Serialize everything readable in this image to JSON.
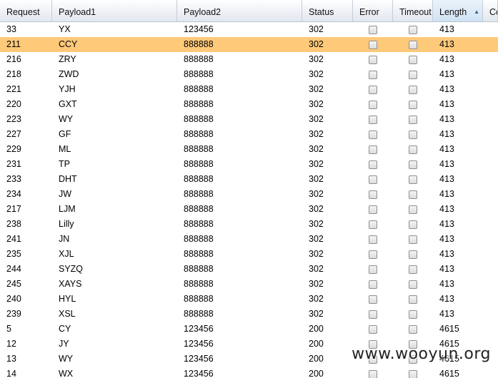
{
  "columns": {
    "request": "Request",
    "payload1": "Payload1",
    "payload2": "Payload2",
    "status": "Status",
    "error": "Error",
    "timeout": "Timeout",
    "length": "Length",
    "comment": "Co"
  },
  "sort": {
    "column": "Length",
    "direction": "ascending",
    "arrow": "▲"
  },
  "selected_row_index": 1,
  "selection_color": "#ffc97a",
  "rows": [
    {
      "request": "33",
      "payload1": "YX",
      "payload2": "123456",
      "status": "302",
      "error": false,
      "timeout": false,
      "length": "413"
    },
    {
      "request": "211",
      "payload1": "CCY",
      "payload2": "888888",
      "status": "302",
      "error": false,
      "timeout": false,
      "length": "413"
    },
    {
      "request": "216",
      "payload1": "ZRY",
      "payload2": "888888",
      "status": "302",
      "error": false,
      "timeout": false,
      "length": "413"
    },
    {
      "request": "218",
      "payload1": "ZWD",
      "payload2": "888888",
      "status": "302",
      "error": false,
      "timeout": false,
      "length": "413"
    },
    {
      "request": "221",
      "payload1": "YJH",
      "payload2": "888888",
      "status": "302",
      "error": false,
      "timeout": false,
      "length": "413"
    },
    {
      "request": "220",
      "payload1": "GXT",
      "payload2": "888888",
      "status": "302",
      "error": false,
      "timeout": false,
      "length": "413"
    },
    {
      "request": "223",
      "payload1": "WY",
      "payload2": "888888",
      "status": "302",
      "error": false,
      "timeout": false,
      "length": "413"
    },
    {
      "request": "227",
      "payload1": "GF",
      "payload2": "888888",
      "status": "302",
      "error": false,
      "timeout": false,
      "length": "413"
    },
    {
      "request": "229",
      "payload1": "ML",
      "payload2": "888888",
      "status": "302",
      "error": false,
      "timeout": false,
      "length": "413"
    },
    {
      "request": "231",
      "payload1": "TP",
      "payload2": "888888",
      "status": "302",
      "error": false,
      "timeout": false,
      "length": "413"
    },
    {
      "request": "233",
      "payload1": "DHT",
      "payload2": "888888",
      "status": "302",
      "error": false,
      "timeout": false,
      "length": "413"
    },
    {
      "request": "234",
      "payload1": "JW",
      "payload2": "888888",
      "status": "302",
      "error": false,
      "timeout": false,
      "length": "413"
    },
    {
      "request": "217",
      "payload1": "LJM",
      "payload2": "888888",
      "status": "302",
      "error": false,
      "timeout": false,
      "length": "413"
    },
    {
      "request": "238",
      "payload1": "Lilly",
      "payload2": "888888",
      "status": "302",
      "error": false,
      "timeout": false,
      "length": "413"
    },
    {
      "request": "241",
      "payload1": "JN",
      "payload2": "888888",
      "status": "302",
      "error": false,
      "timeout": false,
      "length": "413"
    },
    {
      "request": "235",
      "payload1": "XJL",
      "payload2": "888888",
      "status": "302",
      "error": false,
      "timeout": false,
      "length": "413"
    },
    {
      "request": "244",
      "payload1": "SYZQ",
      "payload2": "888888",
      "status": "302",
      "error": false,
      "timeout": false,
      "length": "413"
    },
    {
      "request": "245",
      "payload1": "XAYS",
      "payload2": "888888",
      "status": "302",
      "error": false,
      "timeout": false,
      "length": "413"
    },
    {
      "request": "240",
      "payload1": "HYL",
      "payload2": "888888",
      "status": "302",
      "error": false,
      "timeout": false,
      "length": "413"
    },
    {
      "request": "239",
      "payload1": "XSL",
      "payload2": "888888",
      "status": "302",
      "error": false,
      "timeout": false,
      "length": "413"
    },
    {
      "request": "5",
      "payload1": "CY",
      "payload2": "123456",
      "status": "200",
      "error": false,
      "timeout": false,
      "length": "4615"
    },
    {
      "request": "12",
      "payload1": "JY",
      "payload2": "123456",
      "status": "200",
      "error": false,
      "timeout": false,
      "length": "4615"
    },
    {
      "request": "13",
      "payload1": "WY",
      "payload2": "123456",
      "status": "200",
      "error": false,
      "timeout": false,
      "length": "4615"
    },
    {
      "request": "14",
      "payload1": "WX",
      "payload2": "123456",
      "status": "200",
      "error": false,
      "timeout": false,
      "length": "4615"
    }
  ],
  "watermark": "www.wooyun.org"
}
